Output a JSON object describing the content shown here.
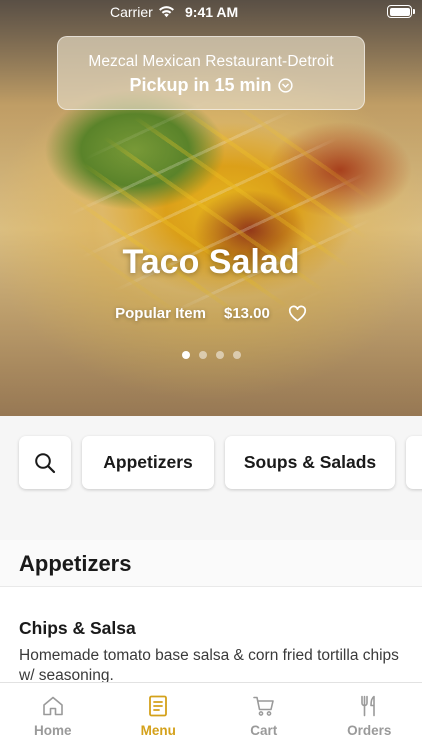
{
  "status_bar": {
    "carrier": "Carrier",
    "time": "9:41 AM"
  },
  "header": {
    "restaurant_name": "Mezcal Mexican Restaurant-Detroit",
    "pickup_label": "Pickup in 15 min"
  },
  "hero": {
    "title": "Taco Salad",
    "tag": "Popular Item",
    "price": "$13.00",
    "carousel_total": 4,
    "carousel_active": 1
  },
  "categories": {
    "search_icon": "search-icon",
    "items": [
      {
        "label": "Appetizers"
      },
      {
        "label": "Soups & Salads"
      },
      {
        "label": ""
      }
    ]
  },
  "section": {
    "title": "Appetizers",
    "items": [
      {
        "name": "Chips & Salsa",
        "description": "Homemade tomato base salsa & corn fried tortilla chips w/ seasoning."
      }
    ]
  },
  "tab_bar": {
    "active": "Menu",
    "tabs": [
      {
        "label": "Home",
        "icon": "home-icon"
      },
      {
        "label": "Menu",
        "icon": "menu-icon"
      },
      {
        "label": "Cart",
        "icon": "cart-icon"
      },
      {
        "label": "Orders",
        "icon": "orders-icon"
      }
    ]
  },
  "colors": {
    "accent": "#d4a11b",
    "inactive": "#9a9a9a"
  }
}
